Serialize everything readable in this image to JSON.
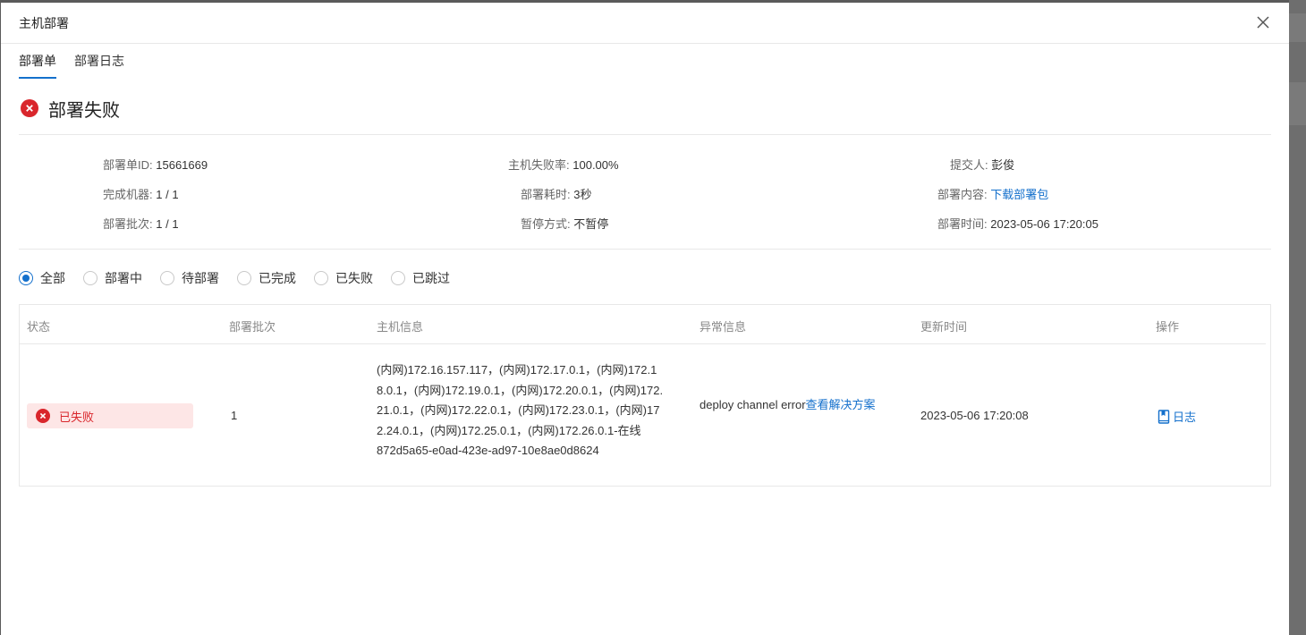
{
  "modal": {
    "title": "主机部署"
  },
  "tabs": [
    {
      "label": "部署单",
      "active": true
    },
    {
      "label": "部署日志",
      "active": false
    }
  ],
  "status": {
    "title": "部署失败",
    "icon": "error-circle-icon",
    "color": "#d9262c"
  },
  "info": {
    "order_id_label": "部署单ID:",
    "order_id_value": "15661669",
    "fail_rate_label": "主机失败率:",
    "fail_rate_value": "100.00%",
    "submitter_label": "提交人:",
    "submitter_value": "彭俊",
    "done_machines_label": "完成机器:",
    "done_machines_value": "1 / 1",
    "duration_label": "部署耗时:",
    "duration_value": "3秒",
    "content_label": "部署内容:",
    "content_link": "下载部署包",
    "batch_label": "部署批次:",
    "batch_value": "1 / 1",
    "pause_label": "暂停方式:",
    "pause_value": "不暂停",
    "time_label": "部署时间:",
    "time_value": "2023-05-06 17:20:05"
  },
  "filters": [
    {
      "label": "全部",
      "checked": true
    },
    {
      "label": "部署中",
      "checked": false
    },
    {
      "label": "待部署",
      "checked": false
    },
    {
      "label": "已完成",
      "checked": false
    },
    {
      "label": "已失败",
      "checked": false
    },
    {
      "label": "已跳过",
      "checked": false
    }
  ],
  "table": {
    "headers": [
      "状态",
      "部署批次",
      "主机信息",
      "异常信息",
      "更新时间",
      "操作"
    ],
    "rows": [
      {
        "status": "已失败",
        "batch": "1",
        "host_info": "(内网)172.16.157.117，(内网)172.17.0.1，(内网)172.18.0.1，(内网)172.19.0.1，(内网)172.20.0.1，(内网)172.21.0.1，(内网)172.22.0.1，(内网)172.23.0.1，(内网)172.24.0.1，(内网)172.25.0.1，(内网)172.26.0.1-在线",
        "host_id": "872d5a65-e0ad-423e-ad97-10e8ae0d8624",
        "error_text": "deploy channel error",
        "error_link": "查看解决方案",
        "updated": "2023-05-06 17:20:08",
        "action": "日志"
      }
    ]
  },
  "colors": {
    "accent": "#1470cc",
    "error": "#d9262c",
    "error_bg": "#fde6e6"
  }
}
